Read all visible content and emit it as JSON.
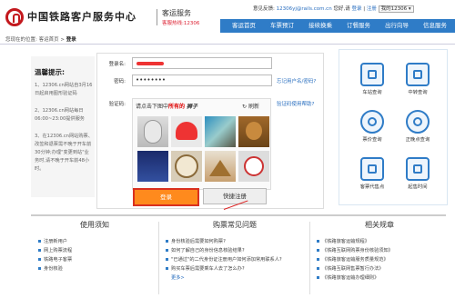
{
  "header": {
    "brand": "中国铁路客户服务中心",
    "sub_brand": "客运服务",
    "hotline": "客服热线:12306",
    "welcome_prefix": "意见反馈:",
    "email": "12306yj@rails.com.cn",
    "mid": "您好,请",
    "login_link": "登录",
    "sep": "|",
    "register_link": "注册",
    "mobile_select": "我的12306 ▾"
  },
  "nav": [
    {
      "label": "客运首页"
    },
    {
      "label": "车票预订"
    },
    {
      "label": "接续换乘"
    },
    {
      "label": "订餐服务"
    },
    {
      "label": "出行向导"
    },
    {
      "label": "信息服务"
    }
  ],
  "breadcrumb": {
    "prefix": "您现在的位置:",
    "home": "客运首页",
    "sep": ">",
    "current": "登录"
  },
  "notice": {
    "title": "温馨提示:",
    "items": [
      "1、12306.cn网站自3月16日起启用图形验证码",
      "2、12306.cn网站每日06:00~23:00提供服务",
      "3、在12306.cn网站购票、改签和退票需不晚于开车前30分钟;办理\"变更到站\"业务时,请不晚于开车前48小时。"
    ]
  },
  "login": {
    "username_label": "登录名:",
    "username_value": "",
    "password_label": "密码:",
    "password_value": "••••••••",
    "forgot_link": "忘记用户名/密码?",
    "captcha_label": "验证码:",
    "captcha_help": "验证码使用帮助?",
    "captcha_question_prefix": "请点击下图中",
    "captcha_question_highlight": "所有的",
    "captcha_question_object": "狮子",
    "refresh_label": "刷新",
    "login_button": "登录",
    "register_button": "快捷注册"
  },
  "services": [
    {
      "label": "车站查询",
      "icon": "station-icon"
    },
    {
      "label": "中转查询",
      "icon": "transfer-icon"
    },
    {
      "label": "票价查询",
      "icon": "price-icon"
    },
    {
      "label": "正晚点查询",
      "icon": "clock-icon"
    },
    {
      "label": "客票代售点",
      "icon": "agent-icon"
    },
    {
      "label": "起售时间",
      "icon": "sale-time-icon"
    }
  ],
  "bottom": {
    "col1": {
      "title": "使用须知",
      "items": [
        "注册新用户",
        "网上购票流程",
        "铁路电子客票",
        "身份核验"
      ]
    },
    "col2": {
      "title": "购票常见问题",
      "items": [
        "身份核验后需要如何购票?",
        "如何了解自己的身份信息核验结果?",
        "\"已通过\"的二代身份证注册用户如何添加常用联系人?",
        "购买车票后需要乘车人去了怎么办?"
      ],
      "more": "更多>"
    },
    "col3": {
      "title": "相关规章",
      "items": [
        "《铁路旅客运输规程》",
        "《铁路互联网购票身份核验须知》",
        "《铁路旅客运输服务质量规范》",
        "《铁路互联网售票暂行办法》",
        "《铁路旅客运输办理细则》"
      ]
    }
  },
  "colors": {
    "brand_red": "#c3181d",
    "nav_blue": "#2f7cc7",
    "login_orange": "#ff8a1d"
  }
}
